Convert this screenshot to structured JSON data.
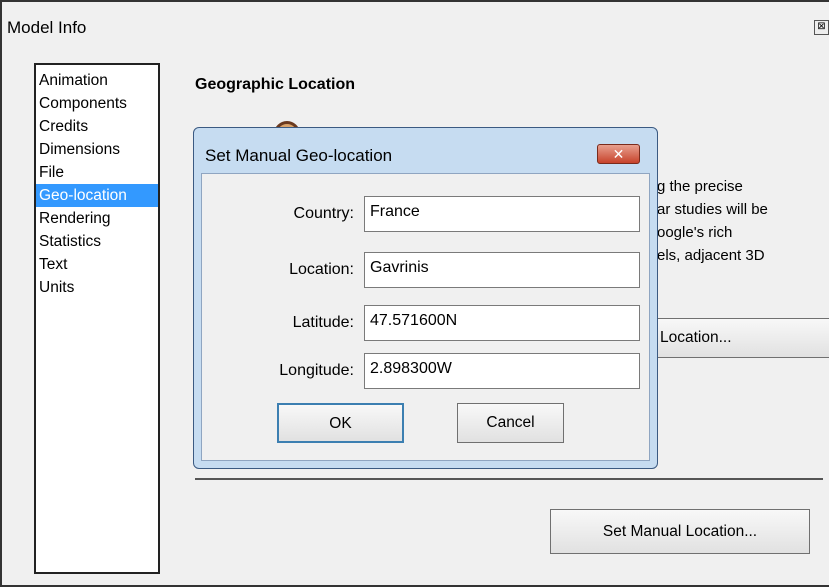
{
  "window": {
    "title": "Model Info",
    "close_glyph": "⊠"
  },
  "sidebar": {
    "items": [
      "Animation",
      "Components",
      "Credits",
      "Dimensions",
      "File",
      "Geo-location",
      "Rendering",
      "Statistics",
      "Text",
      "Units"
    ],
    "selected": "Geo-location"
  },
  "main": {
    "section_title": "Geographic Location",
    "description_lines": [
      "g the precise",
      "ar studies will be",
      "oogle's rich",
      "els, adjacent 3D"
    ],
    "partial_button_label": "Location...",
    "set_manual_button": "Set Manual Location..."
  },
  "dialog": {
    "title": "Set Manual Geo-location",
    "close_glyph": "✕",
    "fields": {
      "country": {
        "label": "Country:",
        "value": "France"
      },
      "location": {
        "label": "Location:",
        "value": "Gavrinis"
      },
      "latitude": {
        "label": "Latitude:",
        "value": "47.571600N"
      },
      "longitude": {
        "label": "Longitude:",
        "value": "2.898300W"
      }
    },
    "ok_label": "OK",
    "cancel_label": "Cancel"
  },
  "colors": {
    "selection": "#3399ff",
    "dialog_frame": "#c6dcf1",
    "close_red": "#c7432b"
  },
  "icons": {
    "location": "globe-icon"
  }
}
